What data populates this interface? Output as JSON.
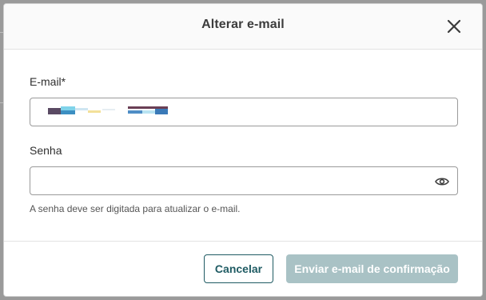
{
  "dialog": {
    "title": "Alterar e-mail",
    "close_icon": "close-icon"
  },
  "form": {
    "email_label": "E-mail*",
    "email_value": "",
    "password_label": "Senha",
    "password_value": "",
    "password_icon": "eye-icon",
    "hint": "A senha deve ser digitada para atualizar o e-mail."
  },
  "actions": {
    "cancel_label": "Cancelar",
    "confirm_label": "Enviar e-mail de confirmação"
  },
  "colors": {
    "primary": "#1f5b63",
    "disabled_button": "#a9c2c5",
    "overlay": "#9a9a9a"
  }
}
